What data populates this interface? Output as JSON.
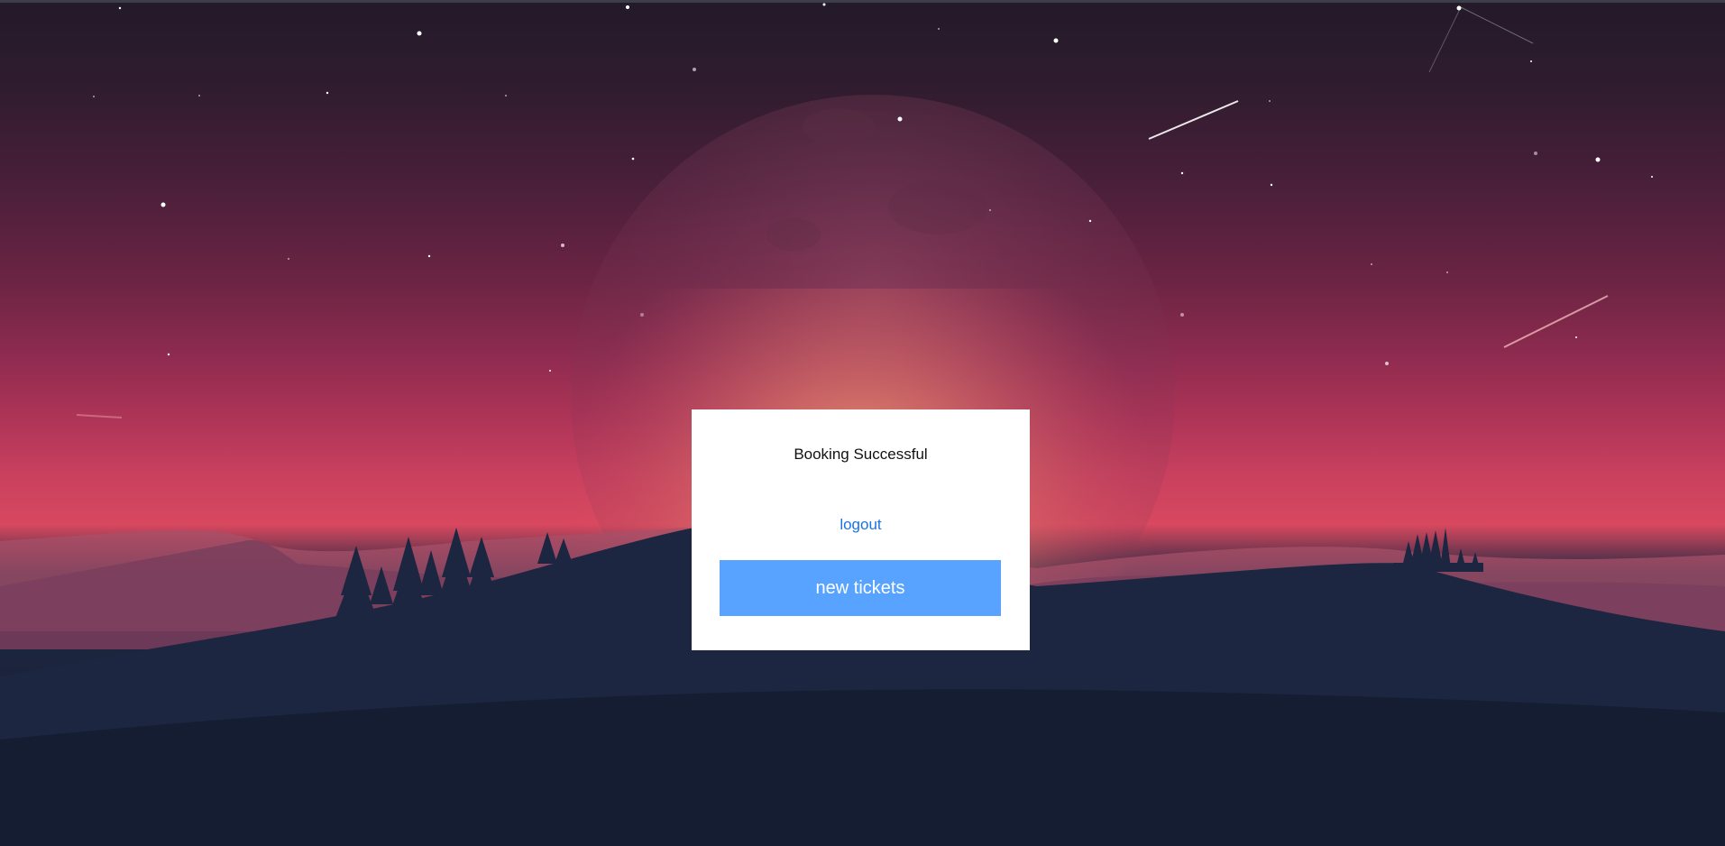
{
  "card": {
    "title": "Booking Successful",
    "logout_label": "logout",
    "new_tickets_label": "new tickets"
  },
  "colors": {
    "button_bg": "#57a3ff",
    "link": "#1a73e8",
    "card_bg": "#ffffff"
  }
}
